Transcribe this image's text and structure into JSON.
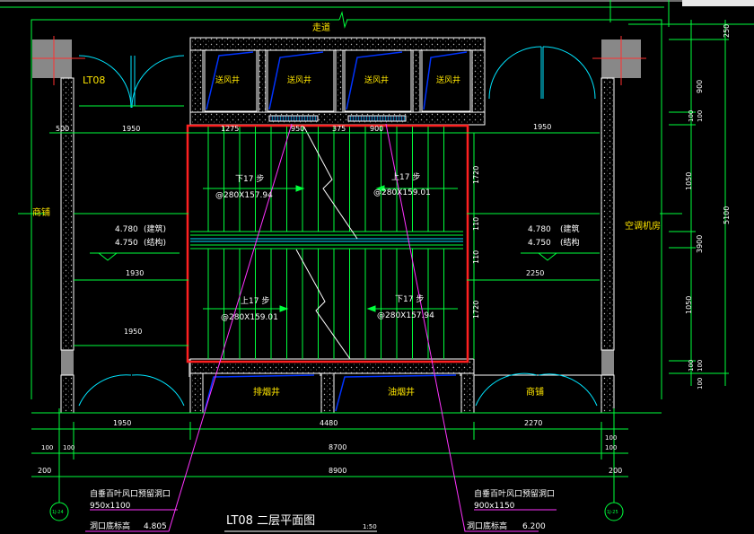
{
  "colors": {
    "background": "#000000",
    "wall": "#ffffff",
    "dimension": "#00ff3c",
    "room_label": "#ffe600",
    "door_arc": "#00e5ff",
    "shaft_fill": "#0033ff",
    "leader": "#ff33ff",
    "highlight": "#ff2020",
    "grid_bubble": "#00ff3c"
  },
  "top_corridor": "走道",
  "elevator_id": "LT08",
  "shafts_top": [
    "送风井",
    "送风井",
    "送风井",
    "送风井"
  ],
  "shafts_bottom": [
    "排烟井",
    "油烟井"
  ],
  "rooms": {
    "left": "商铺",
    "right": "空调机房",
    "bottom_right": "商铺"
  },
  "left_levels": [
    {
      "value": "4.780",
      "type": "(建筑)"
    },
    {
      "value": "4.750",
      "type": "(结构)"
    }
  ],
  "right_levels": [
    {
      "value": "4.780",
      "type": "(建筑"
    },
    {
      "value": "4.750",
      "type": "(结构"
    }
  ],
  "stairs": [
    {
      "direction": "下17 步",
      "spec": "@280X157.94"
    },
    {
      "direction": "上17 步",
      "spec": "@280X159.01"
    },
    {
      "direction": "上17 步",
      "spec": "@280X159.01"
    },
    {
      "direction": "下17 步",
      "spec": "@280X157.94"
    }
  ],
  "dims_top_row": [
    "500",
    "1950",
    "1275",
    "950",
    "375",
    "900",
    "1950"
  ],
  "dims_mid_left": "1930",
  "dims_mid_right": "2250",
  "dims_low_left": "1950",
  "dims_stair_vert": [
    "1720",
    "110",
    "110",
    "1720"
  ],
  "dims_right_col": [
    "250",
    "900",
    "100",
    "100",
    "1050",
    "3900",
    "1050",
    "100",
    "100",
    "5100",
    "100"
  ],
  "dims_bottom_row1": [
    "1950",
    "4480",
    "2270"
  ],
  "dims_bottom_row2": [
    "100",
    "100",
    "8700",
    "100",
    "100"
  ],
  "dims_bottom_row3": [
    "200",
    "8900",
    "200"
  ],
  "grid_bubbles": [
    "1J-24",
    "1J-25"
  ],
  "note_left": {
    "title": "自垂百叶风口预留洞口",
    "size": "950x1100",
    "elev_label": "洞口底标高",
    "elev_value": "4.805"
  },
  "note_right": {
    "title": "自垂百叶风口预留洞口",
    "size": "900x1150",
    "elev_label": "洞口底标高",
    "elev_value": "6.200"
  },
  "drawing_title": "LT08 二层平面图",
  "scale": "1:50"
}
